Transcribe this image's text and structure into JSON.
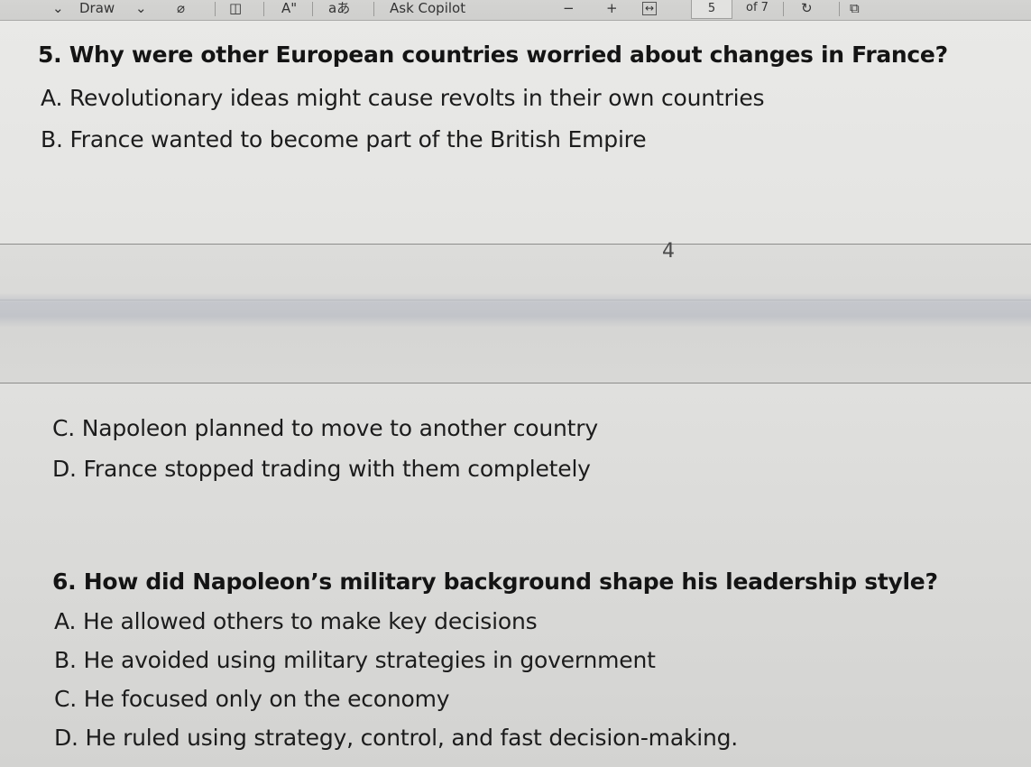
{
  "toolbar": {
    "draw_label": "Draw",
    "text_size_label": "A\"",
    "translate_label": "aあ",
    "ask_copilot_label": "Ask Copilot",
    "zoom_out": "−",
    "zoom_in": "+",
    "page_current": "5",
    "page_total": "of 7"
  },
  "page_number_footer": "4",
  "question5": {
    "text": "5. Why were other European countries worried about changes in France?",
    "options": [
      "A. Revolutionary ideas might cause revolts in their own countries",
      "B. France wanted to become part of the British Empire",
      "C. Napoleon planned to move to another country",
      "D. France stopped trading with them completely"
    ]
  },
  "question6": {
    "text": "6. How did Napoleon’s military background shape his leadership style?",
    "options": [
      "A. He allowed others to make key decisions",
      "B. He avoided using military strategies in government",
      "C. He focused only on the economy",
      "D. He ruled using strategy, control, and fast decision-making."
    ]
  }
}
